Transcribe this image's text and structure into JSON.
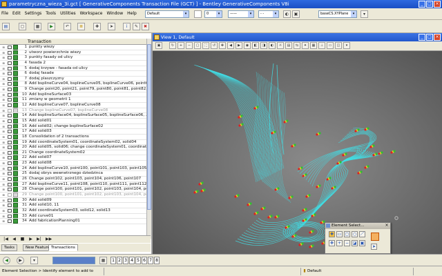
{
  "window": {
    "title": "parametryczna_wieza_3i.gct [ GenerativeComponents Transaction File (GCT) ] - Bentley GenerativeComponents V8i"
  },
  "menu": {
    "items": [
      "File",
      "Edit",
      "Settings",
      "Tools",
      "Utilities",
      "Workspace",
      "Window",
      "Help"
    ],
    "level_combo": "Default",
    "weight_value": "0",
    "plane_combo": "baseCS.XYPlane"
  },
  "transactions": {
    "column_header": "Transaction",
    "rows": [
      {
        "num": "1",
        "label": "punkty wiezy",
        "disabled": false
      },
      {
        "num": "2",
        "label": "utworz powierzchnie wiezy",
        "disabled": false
      },
      {
        "num": "3",
        "label": "punkty fasady od ulicy",
        "disabled": false
      },
      {
        "num": "4",
        "label": "fasada 2",
        "disabled": false
      },
      {
        "num": "5",
        "label": "dodaj krzywe - fasada od ulicy",
        "disabled": false
      },
      {
        "num": "6",
        "label": "dodaj fasade",
        "disabled": false
      },
      {
        "num": "7",
        "label": "dodaj plaszczyzny",
        "disabled": false
      },
      {
        "num": "8",
        "label": "Add bsplineCurve04, bsplineCurve05, bsplineCurve06, point69, poi",
        "disabled": false
      },
      {
        "num": "9",
        "label": "Change point20, point21, point79, point80, point81, point82, point83",
        "disabled": false
      },
      {
        "num": "10",
        "label": "Add bsplineSurface03",
        "disabled": false
      },
      {
        "num": "11",
        "label": "zmiany w geometrii 1",
        "disabled": false
      },
      {
        "num": "12",
        "label": "Add bsplineCurve07, bsplineCurve08",
        "disabled": false
      },
      {
        "num": "13",
        "label": "Change bsplineCurve07, bsplineCurve08",
        "disabled": true
      },
      {
        "num": "14",
        "label": "Add bsplineSurface04, bsplineSurface05, bsplineSurface06, ...",
        "disabled": false
      },
      {
        "num": "15",
        "label": "Add solid01",
        "disabled": false
      },
      {
        "num": "16",
        "label": "Add solid02; change bsplineSurface02",
        "disabled": false
      },
      {
        "num": "17",
        "label": "Add solid03",
        "disabled": false
      },
      {
        "num": "18",
        "label": "Consolidation of 2 transactions",
        "disabled": false
      },
      {
        "num": "19",
        "label": "Add coordinateSystem01, coordinateSystem02, solid04",
        "disabled": false
      },
      {
        "num": "20",
        "label": "Add solid05, solid06; change coordinateSystem01, coordinateSyste",
        "disabled": false
      },
      {
        "num": "21",
        "label": "Change coordinateSystem02",
        "disabled": false
      },
      {
        "num": "22",
        "label": "Add solid07",
        "disabled": false
      },
      {
        "num": "23",
        "label": "Add solid08",
        "disabled": false
      },
      {
        "num": "24",
        "label": "Add bsplineCurve10, point100, point101, point103, point105, point1",
        "disabled": false
      },
      {
        "num": "25",
        "label": "dodaj obrys wewnetrznego dziedzinca",
        "disabled": false
      },
      {
        "num": "26",
        "label": "Change point102, point103, point104, point106, point107",
        "disabled": false
      },
      {
        "num": "27",
        "label": "Add bsplineCurve11, point108, point110, point111, point112, point1",
        "disabled": false
      },
      {
        "num": "28",
        "label": "Change point100, point101, point102, point103, point104, point108",
        "disabled": false
      },
      {
        "num": "29",
        "label": "Change point100, point101, point102, point103, point104, point105",
        "disabled": true
      },
      {
        "num": "30",
        "label": "Add solid09",
        "disabled": false
      },
      {
        "num": "31",
        "label": "Add solid10, 11",
        "disabled": false
      },
      {
        "num": "32",
        "label": "Add coordinateSystem03, solid12, solid13",
        "disabled": false
      },
      {
        "num": "33",
        "label": "Add curve01",
        "disabled": false
      },
      {
        "num": "34",
        "label": "Add fabricationPlanning01",
        "disabled": false
      }
    ]
  },
  "bottom_tabs": [
    "Tasks",
    "New Feature",
    "Transactions"
  ],
  "active_tab": "Transactions",
  "view": {
    "title": "View 1, Default"
  },
  "element_selection": {
    "title": "Element Select..."
  },
  "bottom_toolbar": {
    "view_numbers": [
      "1",
      "2",
      "3",
      "4",
      "5",
      "6",
      "7",
      "8"
    ]
  },
  "status": {
    "message": "Element Selection > Identify element to add to",
    "level": "Default"
  },
  "colors": {
    "wireframe": "#40e0e8",
    "point_red": "#e02020",
    "point_yellow": "#f0e020",
    "point_green": "#30c030",
    "title_blue": "#2258cc"
  }
}
